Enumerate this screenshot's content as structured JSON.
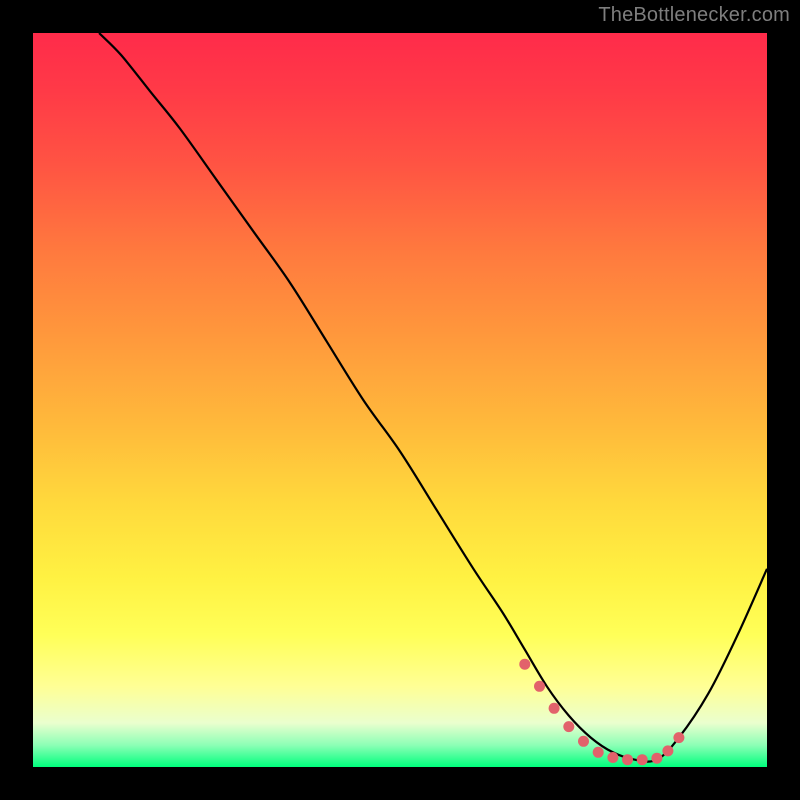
{
  "attribution": "TheBottlenecker.com",
  "chart_data": {
    "type": "line",
    "title": "",
    "xlabel": "",
    "ylabel": "",
    "xlim": [
      0,
      100
    ],
    "ylim": [
      0,
      100
    ],
    "series": [
      {
        "name": "curve",
        "color": "#000000",
        "x": [
          9,
          12,
          16,
          20,
          25,
          30,
          35,
          40,
          45,
          50,
          55,
          60,
          64,
          67,
          70,
          73,
          76,
          79,
          82,
          85,
          88,
          92,
          96,
          100
        ],
        "y": [
          100,
          97,
          92,
          87,
          80,
          73,
          66,
          58,
          50,
          43,
          35,
          27,
          21,
          16,
          11,
          7,
          4,
          2,
          1,
          1,
          4,
          10,
          18,
          27
        ]
      },
      {
        "name": "optimal-dots",
        "color": "#e2626b",
        "x": [
          67,
          69,
          71,
          73,
          75,
          77,
          79,
          81,
          83,
          85,
          86.5,
          88
        ],
        "y": [
          14,
          11,
          8,
          5.5,
          3.5,
          2,
          1.3,
          1,
          1,
          1.2,
          2.2,
          4
        ]
      }
    ]
  }
}
